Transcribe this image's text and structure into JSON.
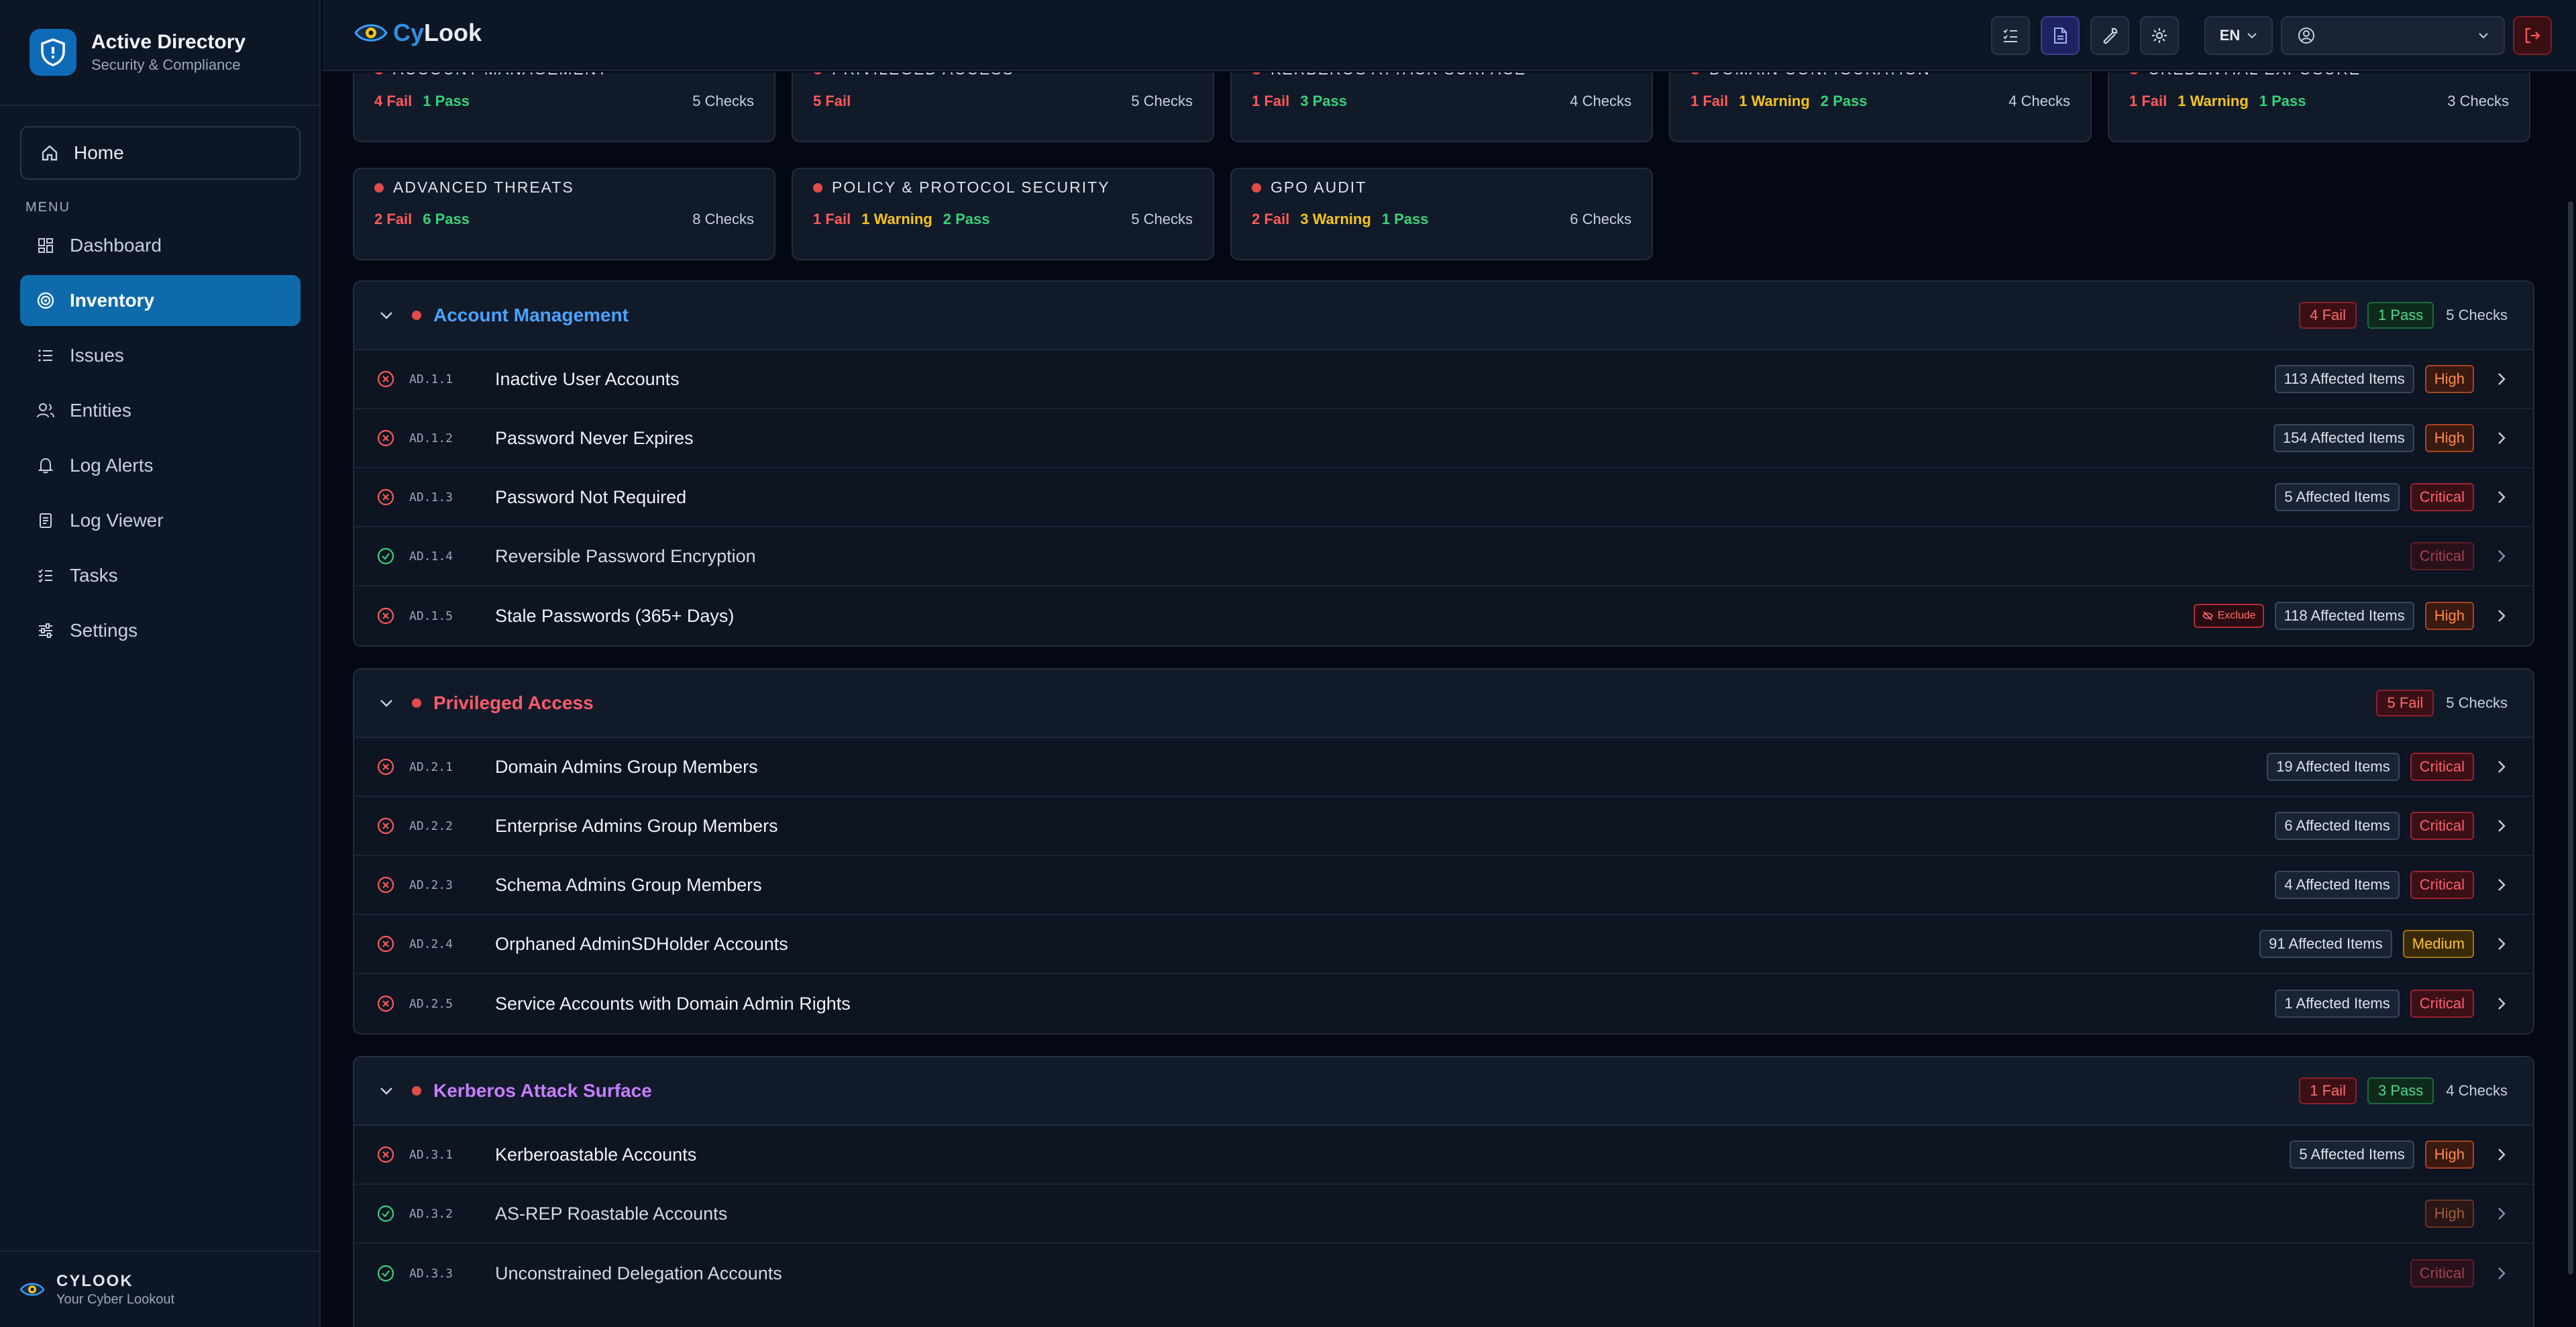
{
  "sidebar": {
    "brand_title": "Active Directory",
    "brand_sub": "Security & Compliance",
    "home_label": "Home",
    "menu_label": "MENU",
    "items": [
      {
        "label": "Dashboard",
        "icon": "dashboard-icon"
      },
      {
        "label": "Inventory",
        "icon": "target-icon",
        "active": true
      },
      {
        "label": "Issues",
        "icon": "list-icon"
      },
      {
        "label": "Entities",
        "icon": "users-icon"
      },
      {
        "label": "Log Alerts",
        "icon": "bell-icon"
      },
      {
        "label": "Log Viewer",
        "icon": "scroll-icon"
      },
      {
        "label": "Tasks",
        "icon": "checklist-icon"
      },
      {
        "label": "Settings",
        "icon": "sliders-icon"
      }
    ],
    "footer_title": "CYLOOK",
    "footer_sub": "Your Cyber Lookout"
  },
  "topbar": {
    "logo_cy": "Cy",
    "logo_look": "Look",
    "lang": "EN",
    "user_value": ""
  },
  "colors": {
    "accent": "#0e6aab",
    "fail": "#ff5a5a",
    "pass": "#38d27a",
    "warning": "#f5c518"
  },
  "cards": [
    {
      "title": "ACCOUNT MANAGEMENT",
      "fail": "4 Fail",
      "warn": "",
      "pass": "1 Pass",
      "checks": "5 Checks"
    },
    {
      "title": "PRIVILEGED ACCESS",
      "fail": "5 Fail",
      "warn": "",
      "pass": "",
      "checks": "5 Checks"
    },
    {
      "title": "KERBEROS ATTACK SURFACE",
      "fail": "1 Fail",
      "warn": "",
      "pass": "3 Pass",
      "checks": "4 Checks"
    },
    {
      "title": "DOMAIN CONFIGURATION",
      "fail": "1 Fail",
      "warn": "1 Warning",
      "pass": "2 Pass",
      "checks": "4 Checks"
    },
    {
      "title": "CREDENTIAL EXPOSURE",
      "fail": "1 Fail",
      "warn": "1 Warning",
      "pass": "1 Pass",
      "checks": "3 Checks"
    },
    {
      "title": "ADVANCED THREATS",
      "fail": "2 Fail",
      "warn": "",
      "pass": "6 Pass",
      "checks": "8 Checks"
    },
    {
      "title": "POLICY & PROTOCOL SECURITY",
      "fail": "1 Fail",
      "warn": "1 Warning",
      "pass": "2 Pass",
      "checks": "5 Checks"
    },
    {
      "title": "GPO AUDIT",
      "fail": "2 Fail",
      "warn": "3 Warning",
      "pass": "1 Pass",
      "checks": "6 Checks"
    }
  ],
  "sections": [
    {
      "title": "Account Management",
      "title_color": "#4aa3ff",
      "fail": "4 Fail",
      "pass": "1 Pass",
      "checks": "5 Checks",
      "rows": [
        {
          "status": "fail",
          "code": "AD.1.1",
          "name": "Inactive User Accounts",
          "affected": "113 Affected Items",
          "severity": "High",
          "exclude": ""
        },
        {
          "status": "fail",
          "code": "AD.1.2",
          "name": "Password Never Expires",
          "affected": "154 Affected Items",
          "severity": "High",
          "exclude": ""
        },
        {
          "status": "fail",
          "code": "AD.1.3",
          "name": "Password Not Required",
          "affected": "5 Affected Items",
          "severity": "Critical",
          "exclude": ""
        },
        {
          "status": "pass",
          "code": "AD.1.4",
          "name": "Reversible Password Encryption",
          "affected": "",
          "severity": "Critical",
          "exclude": ""
        },
        {
          "status": "fail",
          "code": "AD.1.5",
          "name": "Stale Passwords (365+ Days)",
          "affected": "118 Affected Items",
          "severity": "High",
          "exclude": "Exclude"
        }
      ]
    },
    {
      "title": "Privileged Access",
      "title_color": "#ff5a6a",
      "fail": "5 Fail",
      "pass": "",
      "checks": "5 Checks",
      "rows": [
        {
          "status": "fail",
          "code": "AD.2.1",
          "name": "Domain Admins Group Members",
          "affected": "19 Affected Items",
          "severity": "Critical",
          "exclude": ""
        },
        {
          "status": "fail",
          "code": "AD.2.2",
          "name": "Enterprise Admins Group Members",
          "affected": "6 Affected Items",
          "severity": "Critical",
          "exclude": ""
        },
        {
          "status": "fail",
          "code": "AD.2.3",
          "name": "Schema Admins Group Members",
          "affected": "4 Affected Items",
          "severity": "Critical",
          "exclude": ""
        },
        {
          "status": "fail",
          "code": "AD.2.4",
          "name": "Orphaned AdminSDHolder Accounts",
          "affected": "91 Affected Items",
          "severity": "Medium",
          "exclude": ""
        },
        {
          "status": "fail",
          "code": "AD.2.5",
          "name": "Service Accounts with Domain Admin Rights",
          "affected": "1 Affected Items",
          "severity": "Critical",
          "exclude": ""
        }
      ]
    },
    {
      "title": "Kerberos Attack Surface",
      "title_color": "#c77dff",
      "fail": "1 Fail",
      "pass": "3 Pass",
      "checks": "4 Checks",
      "rows": [
        {
          "status": "fail",
          "code": "AD.3.1",
          "name": "Kerberoastable Accounts",
          "affected": "5 Affected Items",
          "severity": "High",
          "exclude": ""
        },
        {
          "status": "pass",
          "code": "AD.3.2",
          "name": "AS-REP Roastable Accounts",
          "affected": "",
          "severity": "High",
          "exclude": ""
        },
        {
          "status": "pass",
          "code": "AD.3.3",
          "name": "Unconstrained Delegation Accounts",
          "affected": "",
          "severity": "Critical",
          "exclude": ""
        }
      ]
    }
  ]
}
